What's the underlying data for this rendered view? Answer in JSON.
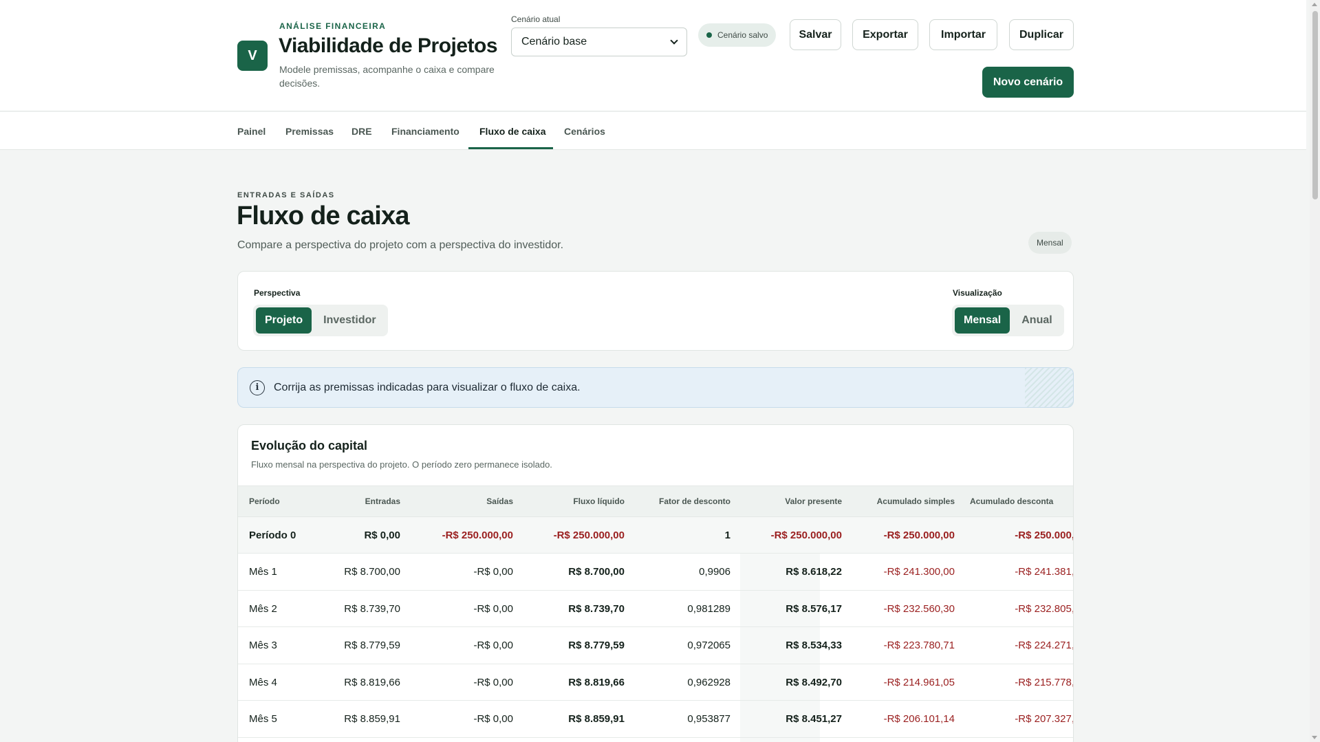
{
  "app": {
    "logo_letter": "V",
    "eyebrow": "ANÁLISE FINANCEIRA",
    "title": "Viabilidade de Projetos",
    "subtitle": "Modele premissas, acompanhe o caixa e compare decisões."
  },
  "scenario": {
    "label": "Cenário atual",
    "selected": "Cenário base",
    "status": "Cenário salvo"
  },
  "actions": {
    "save": "Salvar",
    "export": "Exportar",
    "import": "Importar",
    "duplicate": "Duplicar",
    "new_scenario": "Novo cenário"
  },
  "nav": {
    "tabs": [
      "Painel",
      "Premissas",
      "DRE",
      "Financiamento",
      "Fluxo de caixa",
      "Cenários"
    ],
    "active": "Fluxo de caixa"
  },
  "page": {
    "kicker": "ENTRADAS E SAÍDAS",
    "title": "Fluxo de caixa",
    "subtitle": "Compare a perspectiva do projeto com a perspectiva do investidor.",
    "mode_badge": "Mensal"
  },
  "controls": {
    "perspective_label": "Perspectiva",
    "perspective_options": [
      "Projeto",
      "Investidor"
    ],
    "perspective_selected": "Projeto",
    "view_label": "Visualização",
    "view_options": [
      "Mensal",
      "Anual"
    ],
    "view_selected": "Mensal"
  },
  "alert": {
    "text": "Corrija as premissas indicadas para visualizar o fluxo de caixa."
  },
  "table": {
    "title": "Evolução do capital",
    "subtitle": "Fluxo mensal na perspectiva do projeto. O período zero permanece isolado.",
    "columns": [
      "Período",
      "Entradas",
      "Saídas",
      "Fluxo líquido",
      "Fator de desconto",
      "Valor presente",
      "Acumulado simples",
      "Acumulado desconta"
    ],
    "rows": [
      [
        "Período 0",
        "R$ 0,00",
        "-R$ 250.000,00",
        "-R$ 250.000,00",
        "1",
        "-R$ 250.000,00",
        "-R$ 250.000,00",
        "-R$ 250.000,"
      ],
      [
        "Mês 1",
        "R$ 8.700,00",
        "-R$ 0,00",
        "R$ 8.700,00",
        "0,9906",
        "R$ 8.618,22",
        "-R$ 241.300,00",
        "-R$ 241.381,"
      ],
      [
        "Mês 2",
        "R$ 8.739,70",
        "-R$ 0,00",
        "R$ 8.739,70",
        "0,981289",
        "R$ 8.576,17",
        "-R$ 232.560,30",
        "-R$ 232.805,"
      ],
      [
        "Mês 3",
        "R$ 8.779,59",
        "-R$ 0,00",
        "R$ 8.779,59",
        "0,972065",
        "R$ 8.534,33",
        "-R$ 223.780,71",
        "-R$ 224.271,"
      ],
      [
        "Mês 4",
        "R$ 8.819,66",
        "-R$ 0,00",
        "R$ 8.819,66",
        "0,962928",
        "R$ 8.492,70",
        "-R$ 214.961,05",
        "-R$ 215.778,"
      ],
      [
        "Mês 5",
        "R$ 8.859,91",
        "-R$ 0,00",
        "R$ 8.859,91",
        "0,953877",
        "R$ 8.451,27",
        "-R$ 206.101,14",
        "-R$ 207.327,"
      ]
    ]
  },
  "colors": {
    "brand": "#1a6448",
    "negative": "#9a1f1f",
    "info_bg": "#e6f0f8"
  }
}
